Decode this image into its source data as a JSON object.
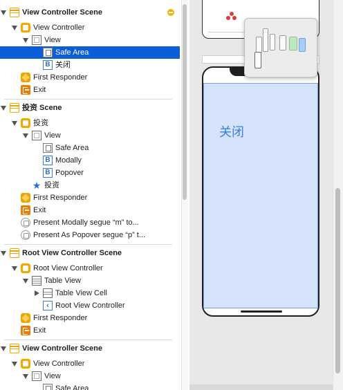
{
  "outline": {
    "rows": [
      {
        "label": "View Controller Scene",
        "indent": 0,
        "icon": "scene-icon",
        "disclosure": "down",
        "scene": true,
        "selected": false,
        "name": "scene-view-controller-1"
      },
      {
        "label": "View Controller",
        "indent": 1,
        "icon": "view-controller-icon",
        "disclosure": "down",
        "scene": false,
        "selected": false,
        "name": "view-controller-1"
      },
      {
        "label": "View",
        "indent": 2,
        "icon": "view-icon",
        "disclosure": "down",
        "scene": false,
        "selected": false,
        "name": "view-1"
      },
      {
        "label": "Safe Area",
        "indent": 3,
        "icon": "safe-area-icon",
        "disclosure": "none",
        "scene": false,
        "selected": true,
        "name": "safe-area-1"
      },
      {
        "label": "关闭",
        "indent": 3,
        "icon": "button-icon",
        "disclosure": "none",
        "scene": false,
        "selected": false,
        "name": "button-close"
      },
      {
        "label": "First Responder",
        "indent": 1,
        "icon": "first-responder-icon",
        "disclosure": "none",
        "scene": false,
        "selected": false,
        "name": "first-responder-1"
      },
      {
        "label": "Exit",
        "indent": 1,
        "icon": "exit-icon",
        "disclosure": "none",
        "scene": false,
        "selected": false,
        "name": "exit-1"
      },
      {
        "label": "投资 Scene",
        "indent": 0,
        "icon": "scene-icon",
        "disclosure": "down",
        "scene": true,
        "selected": false,
        "name": "scene-invest"
      },
      {
        "label": "投资",
        "indent": 1,
        "icon": "view-controller-icon",
        "disclosure": "down",
        "scene": false,
        "selected": false,
        "name": "view-controller-invest"
      },
      {
        "label": "View",
        "indent": 2,
        "icon": "view-icon",
        "disclosure": "down",
        "scene": false,
        "selected": false,
        "name": "view-2"
      },
      {
        "label": "Safe Area",
        "indent": 3,
        "icon": "safe-area-icon",
        "disclosure": "none",
        "scene": false,
        "selected": false,
        "name": "safe-area-2"
      },
      {
        "label": "Modally",
        "indent": 3,
        "icon": "button-icon",
        "disclosure": "none",
        "scene": false,
        "selected": false,
        "name": "button-modally"
      },
      {
        "label": "Popover",
        "indent": 3,
        "icon": "button-icon",
        "disclosure": "none",
        "scene": false,
        "selected": false,
        "name": "button-popover"
      },
      {
        "label": "投资",
        "indent": 2,
        "icon": "tab-bar-item-icon",
        "disclosure": "none",
        "scene": false,
        "selected": false,
        "name": "tab-bar-item-invest"
      },
      {
        "label": "First Responder",
        "indent": 1,
        "icon": "first-responder-icon",
        "disclosure": "none",
        "scene": false,
        "selected": false,
        "name": "first-responder-2"
      },
      {
        "label": "Exit",
        "indent": 1,
        "icon": "exit-icon",
        "disclosure": "none",
        "scene": false,
        "selected": false,
        "name": "exit-2"
      },
      {
        "label": "Present Modally segue “m” to...",
        "indent": 1,
        "icon": "segue-icon",
        "disclosure": "none",
        "scene": false,
        "selected": false,
        "name": "segue-modally"
      },
      {
        "label": "Present As Popover segue “p” t...",
        "indent": 1,
        "icon": "segue-icon",
        "disclosure": "none",
        "scene": false,
        "selected": false,
        "name": "segue-popover"
      },
      {
        "label": "Root View Controller Scene",
        "indent": 0,
        "icon": "scene-icon",
        "disclosure": "down",
        "scene": true,
        "selected": false,
        "name": "scene-root"
      },
      {
        "label": "Root View Controller",
        "indent": 1,
        "icon": "view-controller-icon",
        "disclosure": "down",
        "scene": false,
        "selected": false,
        "name": "root-view-controller"
      },
      {
        "label": "Table View",
        "indent": 2,
        "icon": "table-view-icon",
        "disclosure": "down",
        "scene": false,
        "selected": false,
        "name": "table-view"
      },
      {
        "label": "Table View Cell",
        "indent": 3,
        "icon": "table-cell-icon",
        "disclosure": "right",
        "scene": false,
        "selected": false,
        "name": "table-view-cell"
      },
      {
        "label": "Root View Controller",
        "indent": 3,
        "icon": "navigation-item-icon",
        "disclosure": "none",
        "scene": false,
        "selected": false,
        "name": "navigation-item-root"
      },
      {
        "label": "First Responder",
        "indent": 1,
        "icon": "first-responder-icon",
        "disclosure": "none",
        "scene": false,
        "selected": false,
        "name": "first-responder-3"
      },
      {
        "label": "Exit",
        "indent": 1,
        "icon": "exit-icon",
        "disclosure": "none",
        "scene": false,
        "selected": false,
        "name": "exit-3"
      },
      {
        "label": "View Controller Scene",
        "indent": 0,
        "icon": "scene-icon",
        "disclosure": "down",
        "scene": true,
        "selected": false,
        "name": "scene-view-controller-2"
      },
      {
        "label": "View Controller",
        "indent": 1,
        "icon": "view-controller-icon",
        "disclosure": "down",
        "scene": false,
        "selected": false,
        "name": "view-controller-2"
      },
      {
        "label": "View",
        "indent": 2,
        "icon": "view-icon",
        "disclosure": "down",
        "scene": false,
        "selected": false,
        "name": "view-3"
      },
      {
        "label": "Safe Area",
        "indent": 3,
        "icon": "safe-area-icon",
        "disclosure": "none",
        "scene": false,
        "selected": false,
        "name": "safe-area-3"
      }
    ]
  },
  "canvas": {
    "button_label": "关闭"
  },
  "colors": {
    "selection": "#0b5ed7",
    "safe_area_fill": "#d4e2fa",
    "button_text": "#3a7fe6",
    "scene_accent": "#f0a400"
  }
}
